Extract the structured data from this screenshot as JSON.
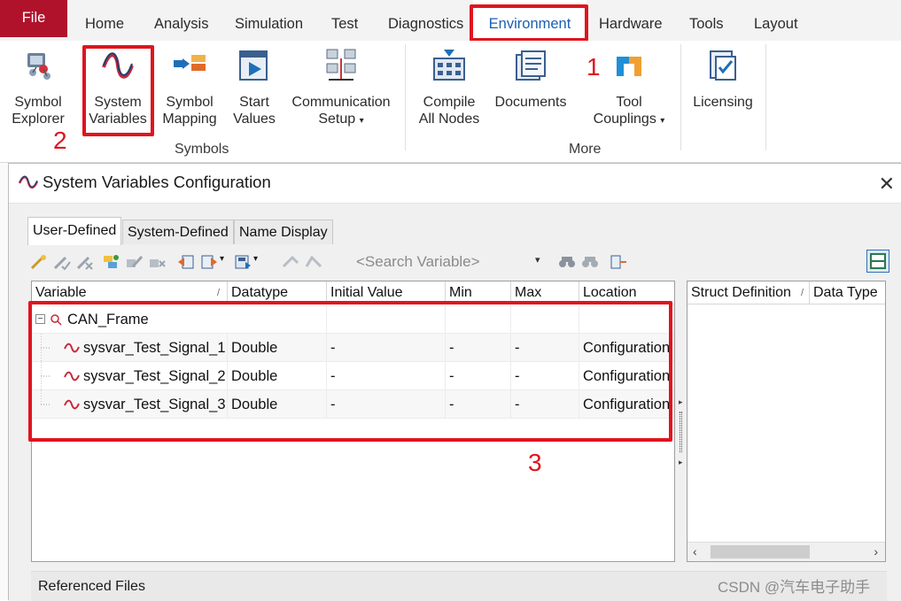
{
  "ribbon_tabs": [
    "File",
    "Home",
    "Analysis",
    "Simulation",
    "Test",
    "Diagnostics",
    "Environment",
    "Hardware",
    "Tools",
    "Layout"
  ],
  "active_tab": "Environment",
  "ribbon": {
    "buttons": {
      "symbol_explorer": [
        "Symbol",
        "Explorer"
      ],
      "system_variables": [
        "System",
        "Variables"
      ],
      "symbol_mapping": [
        "Symbol",
        "Mapping"
      ],
      "start_values": [
        "Start",
        "Values"
      ],
      "communication_setup": [
        "Communication",
        "Setup"
      ],
      "compile_all_nodes": [
        "Compile",
        "All Nodes"
      ],
      "documents": "Documents",
      "tool_couplings": [
        "Tool",
        "Couplings"
      ],
      "licensing": "Licensing"
    },
    "groups": {
      "symbols": "Symbols",
      "more": "More"
    },
    "dropdown_caret": "▾"
  },
  "annotations": {
    "n1": "1",
    "n2": "2",
    "n3": "3"
  },
  "dialog": {
    "title": "System Variables Configuration",
    "close": "✕",
    "tabs": [
      "User-Defined",
      "System-Defined",
      "Name Display"
    ],
    "active_tab": "User-Defined",
    "search_placeholder": "<Search Variable>",
    "columns": [
      "Variable",
      "Datatype",
      "Initial Value",
      "Min",
      "Max",
      "Location"
    ],
    "tree": {
      "namespace": "CAN_Frame",
      "rows": [
        {
          "variable": "sysvar_Test_Signal_1",
          "datatype": "Double",
          "initial": "-",
          "min": "-",
          "max": "-",
          "location": "Configuration"
        },
        {
          "variable": "sysvar_Test_Signal_2",
          "datatype": "Double",
          "initial": "-",
          "min": "-",
          "max": "-",
          "location": "Configuration"
        },
        {
          "variable": "sysvar_Test_Signal_3",
          "datatype": "Double",
          "initial": "-",
          "min": "-",
          "max": "-",
          "location": "Configuration"
        }
      ]
    },
    "right_columns": [
      "Struct Definition",
      "Data Type"
    ],
    "referenced_files": "Referenced Files"
  },
  "watermark": "CSDN @汽车电子助手",
  "colors": {
    "accent_red": "#e0141e",
    "file_tab": "#b0122c",
    "active_tab_text": "#1a5fb4"
  }
}
